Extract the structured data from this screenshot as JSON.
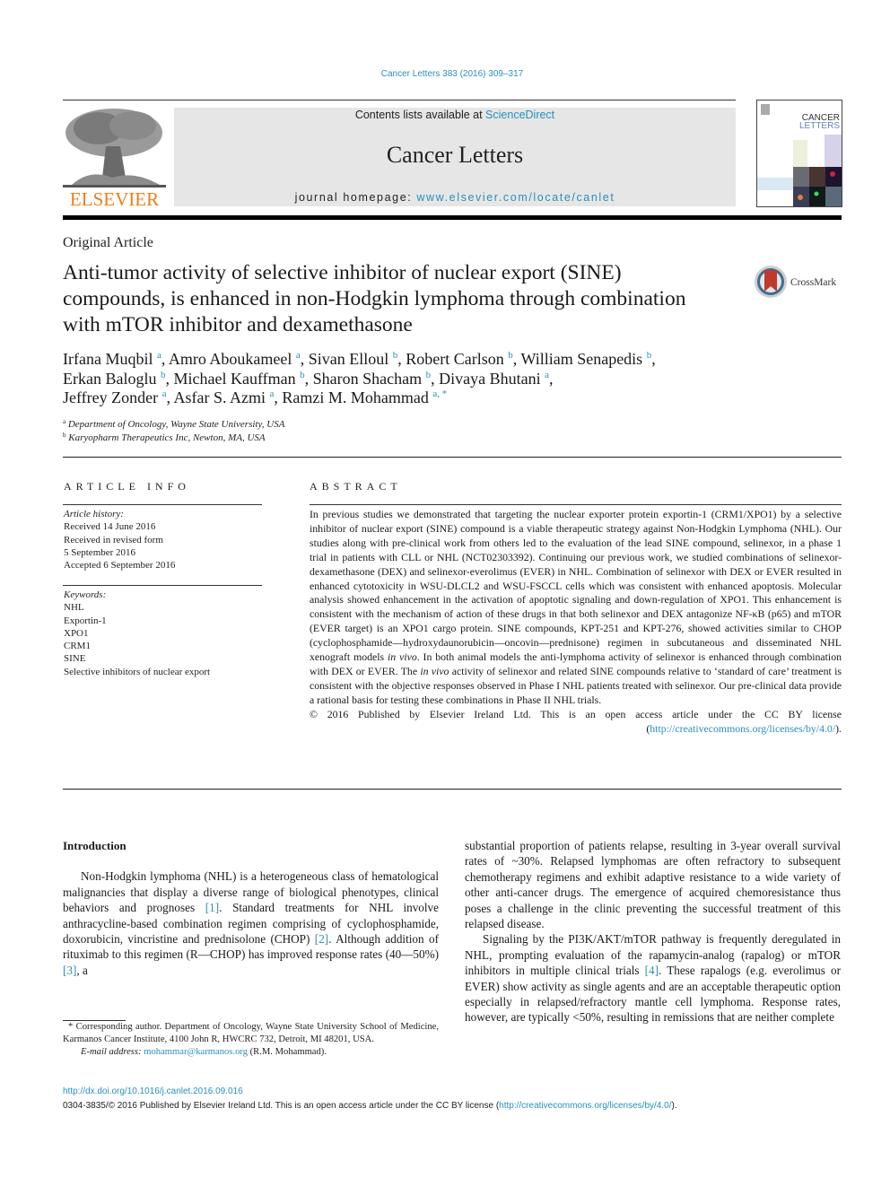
{
  "header": {
    "citation": "Cancer Letters 383 (2016) 309–317",
    "publisher_logo_text": "ELSEVIER",
    "contents_prefix": "Contents lists available at ",
    "contents_link": "ScienceDirect",
    "journal_name": "Cancer Letters",
    "homepage_prefix": "journal homepage: ",
    "homepage_link": "www.elsevier.com/locate/canlet",
    "cover_title_line1": "CANCER",
    "cover_title_line2": "LETTERS",
    "brand_color": "#f07c18",
    "link_color": "#2a8fbd"
  },
  "article": {
    "type": "Original Article",
    "title": "Anti-tumor activity of selective inhibitor of nuclear export (SINE) compounds, is enhanced in non-Hodgkin lymphoma through combination with mTOR inhibitor and dexamethasone",
    "crossmark_label": "CrossMark",
    "authors": [
      {
        "name": "Irfana Muqbil",
        "aff": "a",
        "sep": ", "
      },
      {
        "name": "Amro Aboukameel",
        "aff": "a",
        "sep": ", "
      },
      {
        "name": "Sivan Elloul",
        "aff": "b",
        "sep": ", "
      },
      {
        "name": "Robert Carlson",
        "aff": "b",
        "sep": ", "
      },
      {
        "name": "William Senapedis",
        "aff": "b",
        "sep": ","
      },
      {
        "name": "Erkan Baloglu",
        "aff": "b",
        "sep": ", "
      },
      {
        "name": "Michael Kauffman",
        "aff": "b",
        "sep": ", "
      },
      {
        "name": "Sharon Shacham",
        "aff": "b",
        "sep": ", "
      },
      {
        "name": "Divaya Bhutani",
        "aff": "a",
        "sep": ","
      },
      {
        "name": "Jeffrey Zonder",
        "aff": "a",
        "sep": ", "
      },
      {
        "name": "Asfar S. Azmi",
        "aff": "a",
        "sep": ", "
      },
      {
        "name": "Ramzi M. Mohammad",
        "aff": "a, *",
        "sep": ""
      }
    ],
    "affiliations": [
      {
        "key": "a",
        "text": "Department of Oncology, Wayne State University, USA"
      },
      {
        "key": "b",
        "text": "Karyopharm Therapeutics Inc, Newton, MA, USA"
      }
    ]
  },
  "article_info": {
    "heading": "ARTICLE INFO",
    "history_label": "Article history:",
    "history": [
      "Received 14 June 2016",
      "Received in revised form",
      "5 September 2016",
      "Accepted 6 September 2016"
    ],
    "keywords_label": "Keywords:",
    "keywords": [
      "NHL",
      "Exportin-1",
      "XPO1",
      "CRM1",
      "SINE",
      "Selective inhibitors of nuclear export"
    ]
  },
  "abstract": {
    "heading": "ABSTRACT",
    "part1": "In previous studies we demonstrated that targeting the nuclear exporter protein exportin-1 (CRM1/XPO1) by a selective inhibitor of nuclear export (SINE) compound is a viable therapeutic strategy against Non-Hodgkin Lymphoma (NHL). Our studies along with pre-clinical work from others led to the evaluation of the lead SINE compound, selinexor, in a phase 1 trial in patients with CLL or NHL (NCT02303392). Continuing our previous work, we studied combinations of selinexor-dexamethasone (DEX) and selinexor-everolimus (EVER) in NHL. Combination of selinexor with DEX or EVER resulted in enhanced cytotoxicity in WSU-DLCL2 and WSU-FSCCL cells which was consistent with enhanced apoptosis. Molecular analysis showed enhancement in the activation of apoptotic signaling and down-regulation of XPO1. This enhancement is consistent with the mechanism of action of these drugs in that both selinexor and DEX antagonize NF-κB (p65) and mTOR (EVER target) is an XPO1 cargo protein. SINE compounds, KPT-251 and KPT-276, showed activities similar to CHOP (cyclophosphamide—hydroxydaunorubicin—oncovin—prednisone) regimen in subcutaneous and disseminated NHL xenograft models ",
    "in_vivo_1": "in vivo",
    "part2": ". In both animal models the anti-lymphoma activity of selinexor is enhanced through combination with DEX or EVER. The ",
    "in_vivo_2": "in vivo",
    "part3": " activity of selinexor and related SINE compounds relative to ‘standard of care’ treatment is consistent with the objective responses observed in Phase I NHL patients treated with selinexor. Our pre-clinical data provide a rational basis for testing these combinations in Phase II NHL trials.",
    "license_text": "© 2016 Published by Elsevier Ireland Ltd. This is an open access article under the CC BY license (",
    "license_link": "http://creativecommons.org/licenses/by/4.0/",
    "license_close": ")."
  },
  "body": {
    "intro_heading": "Introduction",
    "left": {
      "p1_a": "Non-Hodgkin lymphoma (NHL) is a heterogeneous class of hematological malignancies that display a diverse range of biological phenotypes, clinical behaviors and prognoses ",
      "ref1": "[1]",
      "p1_b": ". Standard treatments for NHL involve anthracycline-based combination regimen comprising of cyclophosphamide, doxorubicin, vincristine and prednisolone (CHOP) ",
      "ref2": "[2]",
      "p1_c": ". Although addition of rituximab to this regimen (R—CHOP) has improved response rates (40—50%) ",
      "ref3": "[3]",
      "p1_d": ", a"
    },
    "right": {
      "p1": "substantial proportion of patients relapse, resulting in 3-year overall survival rates of ~30%. Relapsed lymphomas are often refractory to subsequent chemotherapy regimens and exhibit adaptive resistance to a wide variety of other anti-cancer drugs. The emergence of acquired chemoresistance thus poses a challenge in the clinic preventing the successful treatment of this relapsed disease.",
      "p2_a": "Signaling by the PI3K/AKT/mTOR pathway is frequently deregulated in NHL, prompting evaluation of the rapamycin-analog (rapalog) or mTOR inhibitors in multiple clinical trials ",
      "ref4": "[4]",
      "p2_b": ". These rapalogs (e.g. everolimus or EVER) show activity as single agents and are an acceptable therapeutic option especially in relapsed/refractory mantle cell lymphoma. Response rates, however, are typically <50%, resulting in remissions that are neither complete"
    }
  },
  "footnote": {
    "corresponding": "* Corresponding author. Department of Oncology, Wayne State University School of Medicine, Karmanos Cancer Institute, 4100 John R, HWCRC 732, Detroit, MI 48201, USA.",
    "email_label": "E-mail address: ",
    "email": "mohammar@karmanos.org",
    "email_suffix": " (R.M. Mohammad)."
  },
  "footer": {
    "doi": "http://dx.doi.org/10.1016/j.canlet.2016.09.016",
    "copyright_prefix": "0304-3835/© 2016 Published by Elsevier Ireland Ltd. This is an open access article under the CC BY license (",
    "copyright_link": "http://creativecommons.org/licenses/by/4.0/",
    "copyright_suffix": ")."
  }
}
